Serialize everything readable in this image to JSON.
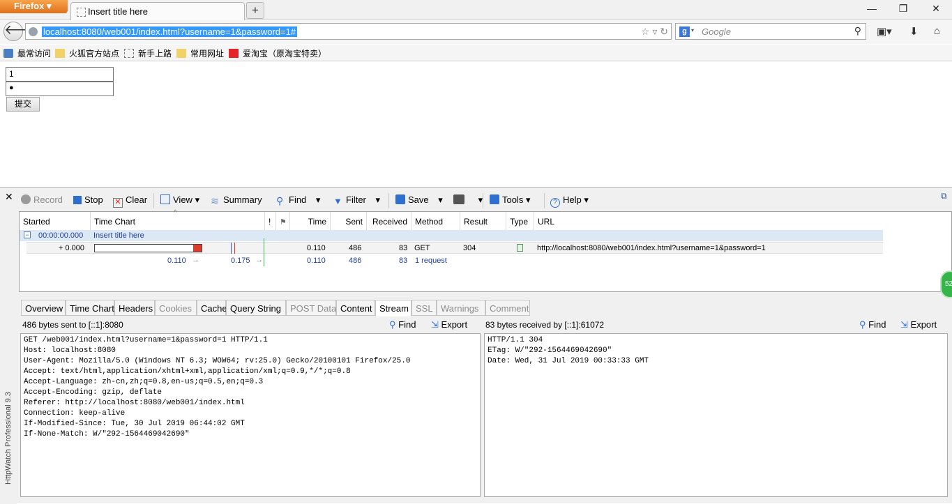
{
  "browser": {
    "app_button": "Firefox",
    "tab_title": "Insert title here",
    "new_tab": "+",
    "url": "localhost:8080/web001/index.html?username=1&password=1#",
    "search_placeholder": "Google",
    "bookmarks": [
      "最常访问",
      "火狐官方站点",
      "新手上路",
      "常用网址",
      "爱淘宝（原淘宝特卖）"
    ]
  },
  "page": {
    "username_value": "1",
    "password_mask": "●",
    "submit_label": "提交"
  },
  "httpwatch": {
    "brand": "HttpWatch Professional 9.3",
    "close": "✕",
    "toolbar": {
      "record": "Record",
      "stop": "Stop",
      "clear": "Clear",
      "view": "View",
      "summary": "Summary",
      "find": "Find",
      "filter": "Filter",
      "save": "Save",
      "tools": "Tools",
      "help": "Help"
    },
    "columns": [
      "Started",
      "Time Chart",
      "!",
      "Time",
      "Sent",
      "Received",
      "Method",
      "Result",
      "Type",
      "URL"
    ],
    "page_row": {
      "started": "00:00:00.000",
      "title": "Insert title here",
      "expand": "−"
    },
    "request_row": {
      "started": "+ 0.000",
      "time": "0.110",
      "sent": "486",
      "received": "83",
      "method": "GET",
      "result": "304",
      "url": "http://localhost:8080/web001/index.html?username=1&password=1"
    },
    "summary_row": {
      "t1": "0.110",
      "t2": "0.175",
      "time": "0.110",
      "sent": "486",
      "received": "83",
      "requests": "1 request"
    },
    "detail_tabs": [
      {
        "label": "Overview",
        "state": "normal"
      },
      {
        "label": "Time Chart",
        "state": "normal"
      },
      {
        "label": "Headers",
        "state": "normal"
      },
      {
        "label": "Cookies",
        "state": "disabled"
      },
      {
        "label": "Cache",
        "state": "normal"
      },
      {
        "label": "Query String",
        "state": "normal"
      },
      {
        "label": "POST Data",
        "state": "disabled"
      },
      {
        "label": "Content",
        "state": "normal"
      },
      {
        "label": "Stream",
        "state": "active"
      },
      {
        "label": "SSL",
        "state": "disabled"
      },
      {
        "label": "Warnings",
        "state": "disabled"
      },
      {
        "label": "Comment",
        "state": "disabled"
      }
    ],
    "sent_label": "486 bytes sent to [::1]:8080",
    "received_label": "83 bytes received by [::1]:61072",
    "find_label": "Find",
    "export_label": "Export",
    "request_stream": "GET /web001/index.html?username=1&password=1 HTTP/1.1\nHost: localhost:8080\nUser-Agent: Mozilla/5.0 (Windows NT 6.3; WOW64; rv:25.0) Gecko/20100101 Firefox/25.0\nAccept: text/html,application/xhtml+xml,application/xml;q=0.9,*/*;q=0.8\nAccept-Language: zh-cn,zh;q=0.8,en-us;q=0.5,en;q=0.3\nAccept-Encoding: gzip, deflate\nReferer: http://localhost:8080/web001/index.html\nConnection: keep-alive\nIf-Modified-Since: Tue, 30 Jul 2019 06:44:02 GMT\nIf-None-Match: W/\"292-1564469042690\"",
    "response_stream": "HTTP/1.1 304\nETag: W/\"292-1564469042690\"\nDate: Wed, 31 Jul 2019 00:33:33 GMT",
    "badge": "52"
  },
  "colors": {
    "accent": "#3399ff",
    "link": "#1f3f9a",
    "firefox_orange": "#e1701c"
  }
}
